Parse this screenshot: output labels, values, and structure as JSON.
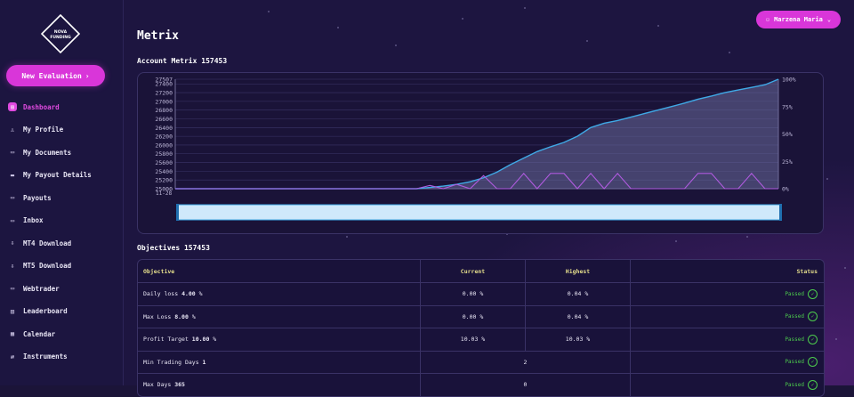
{
  "brand": {
    "logo_text": "NOVA\nFUNDING"
  },
  "sidebar": {
    "new_evaluation": "New Evaluation",
    "items": [
      {
        "label": "Dashboard",
        "icon": "dashboard-icon",
        "active": true
      },
      {
        "label": "My Profile",
        "icon": "user-icon"
      },
      {
        "label": "My Documents",
        "icon": "folder-icon"
      },
      {
        "label": "My Payout Details",
        "icon": "card-icon"
      },
      {
        "label": "Payouts",
        "icon": "wallet-icon"
      },
      {
        "label": "Inbox",
        "icon": "inbox-icon"
      },
      {
        "label": "MT4 Download",
        "icon": "download-icon"
      },
      {
        "label": "MT5 Download",
        "icon": "download-icon"
      },
      {
        "label": "Webtrader",
        "icon": "monitor-icon"
      },
      {
        "label": "Leaderboard",
        "icon": "chart-icon"
      },
      {
        "label": "Calendar",
        "icon": "calendar-icon"
      },
      {
        "label": "Instruments",
        "icon": "exchange-icon"
      }
    ]
  },
  "header": {
    "title": "Metrix",
    "user_name": "Marzena Maria"
  },
  "account_section": {
    "title": "Account Metrix 157453"
  },
  "chart_data": {
    "type": "area",
    "y_left_ticks": [
      "27507",
      "27400",
      "27200",
      "27000",
      "26800",
      "26600",
      "26400",
      "26200",
      "26000",
      "25800",
      "25600",
      "25400",
      "25200",
      "25000"
    ],
    "y_right_ticks": [
      "100%",
      "75%",
      "50%",
      "25%",
      "0%"
    ],
    "x_tick": "11-28",
    "ylim": [
      25000,
      27507
    ],
    "balance": [
      25000,
      25000,
      25000,
      25000,
      25000,
      25000,
      25000,
      25000,
      25000,
      25000,
      25000,
      25000,
      25000,
      25000,
      25000,
      25000,
      25000,
      25000,
      25000,
      25030,
      25060,
      25100,
      25160,
      25250,
      25380,
      25550,
      25700,
      25850,
      25960,
      26060,
      26200,
      26400,
      26500,
      26560,
      26640,
      26720,
      26800,
      26880,
      26960,
      27050,
      27120,
      27200,
      27260,
      27320,
      27380,
      27507
    ],
    "percent": [
      0,
      0,
      0,
      0,
      0,
      0,
      0,
      0,
      0,
      0,
      0,
      0,
      0,
      0,
      0,
      0,
      0,
      0,
      0,
      3,
      0,
      4,
      0,
      12,
      0,
      0,
      14,
      0,
      14,
      14,
      0,
      14,
      0,
      14,
      0,
      0,
      0,
      0,
      0,
      14,
      14,
      0,
      0,
      14,
      0,
      0
    ],
    "colors": {
      "balance": "#3fa9e6",
      "percent": "#b05be0",
      "fill": "#6a6a9a"
    }
  },
  "objectives": {
    "title": "Objectives 157453",
    "headers": [
      "Objective",
      "Current",
      "Highest",
      "Status"
    ],
    "rows": [
      {
        "label": "Daily loss",
        "value": "4.00",
        "unit": "%",
        "current": "0.00 %",
        "highest": "0.04 %",
        "status": "Passed"
      },
      {
        "label": "Max Loss",
        "value": "8.00",
        "unit": "%",
        "current": "0.00 %",
        "highest": "0.04 %",
        "status": "Passed"
      },
      {
        "label": "Profit Target",
        "value": "10.00",
        "unit": "%",
        "current": "10.03 %",
        "highest": "10.03 %",
        "status": "Passed"
      },
      {
        "label": "Min Trading Days",
        "value": "1",
        "unit": "",
        "current": "2",
        "highest": "",
        "status": "Passed",
        "merged": true
      },
      {
        "label": "Max Days",
        "value": "365",
        "unit": "",
        "current": "0",
        "highest": "",
        "status": "Passed",
        "merged": true
      }
    ]
  }
}
